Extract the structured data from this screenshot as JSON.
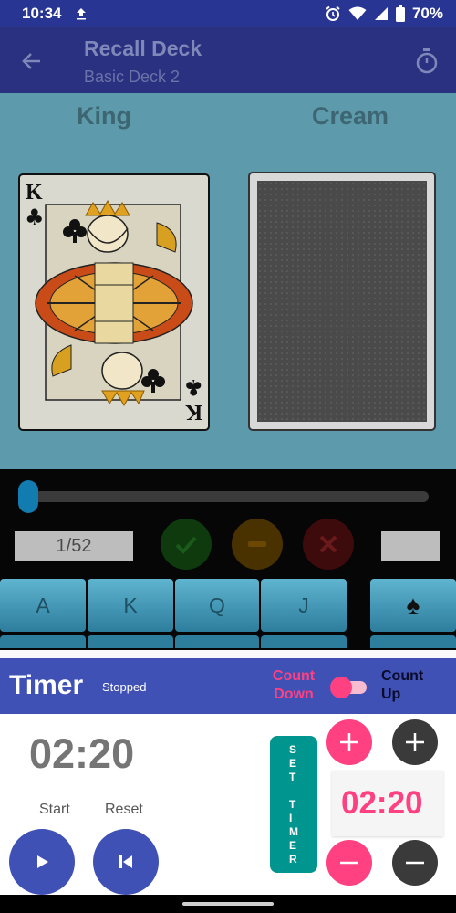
{
  "status_bar": {
    "time": "10:34",
    "battery": "70%",
    "icons": [
      "upload-icon",
      "alarm-icon",
      "wifi-icon",
      "signal-icon",
      "battery-icon"
    ]
  },
  "app_bar": {
    "title": "Recall Deck",
    "subtitle": "Basic Deck 2",
    "icons": [
      "back-arrow-icon",
      "stopwatch-icon"
    ]
  },
  "cards": {
    "left_word": "King",
    "right_word": "Cream",
    "front_rank": "K",
    "front_suit": "♣"
  },
  "controls": {
    "counter": "1/52",
    "slider_fraction": 0.0,
    "icons": [
      "check-icon",
      "minus-icon",
      "close-icon"
    ]
  },
  "keys": [
    "A",
    "K",
    "Q",
    "J",
    "♠"
  ],
  "timer": {
    "title": "Timer",
    "status": "Stopped",
    "count_down": "Count Down",
    "count_up": "Count Up",
    "display": "02:20",
    "start_label": "Start",
    "reset_label": "Reset",
    "set_timer_label": "SET TIMER",
    "set_value": "02:20",
    "colors": {
      "header": "#3f51b5",
      "accent": "#ff4081",
      "set_button": "#00968f"
    }
  }
}
